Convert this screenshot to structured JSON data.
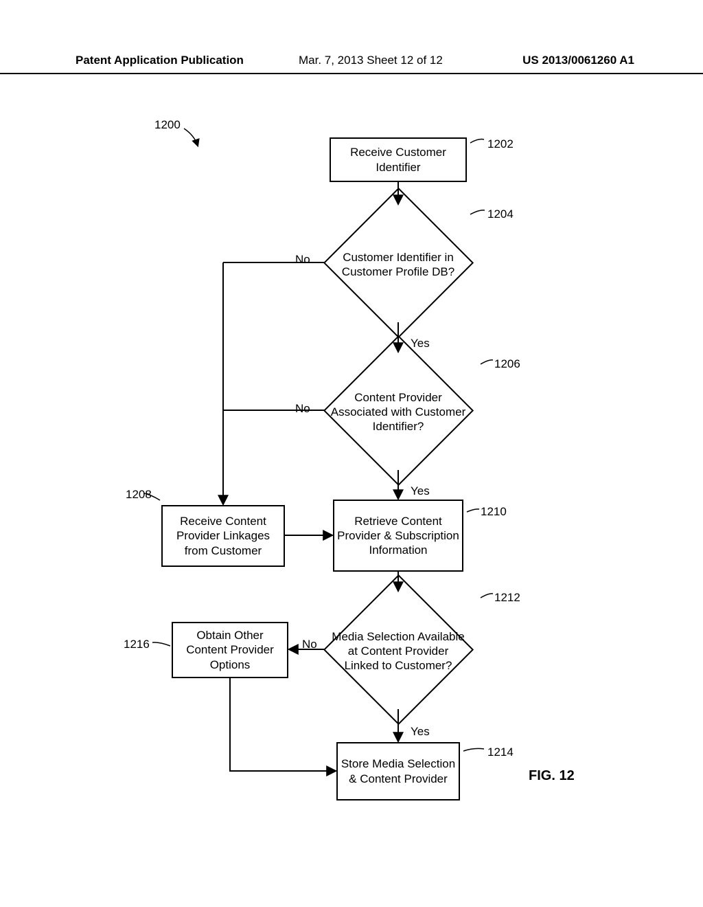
{
  "header": {
    "left": "Patent Application Publication",
    "mid": "Mar. 7, 2013  Sheet 12 of 12",
    "right": "US 2013/0061260 A1"
  },
  "figure": {
    "label": "FIG. 12",
    "ref": "1200"
  },
  "nodes": {
    "n1202": {
      "text": "Receive Customer Identifier",
      "ref": "1202"
    },
    "n1204": {
      "text": "Customer Identifier in Customer Profile DB?",
      "ref": "1204"
    },
    "n1206": {
      "text": "Content Provider Associated with Customer Identifier?",
      "ref": "1206"
    },
    "n1208": {
      "text": "Receive Content Provider Linkages from Customer",
      "ref": "1208"
    },
    "n1210": {
      "text": "Retrieve Content Provider & Subscription Information",
      "ref": "1210"
    },
    "n1212": {
      "text": "Media Selection Available at Content Provider Linked to Customer?",
      "ref": "1212"
    },
    "n1214": {
      "text": "Store Media Selection & Content Provider",
      "ref": "1214"
    },
    "n1216": {
      "text": "Obtain Other Content Provider Options",
      "ref": "1216"
    }
  },
  "edges": {
    "yes": "Yes",
    "no": "No"
  }
}
